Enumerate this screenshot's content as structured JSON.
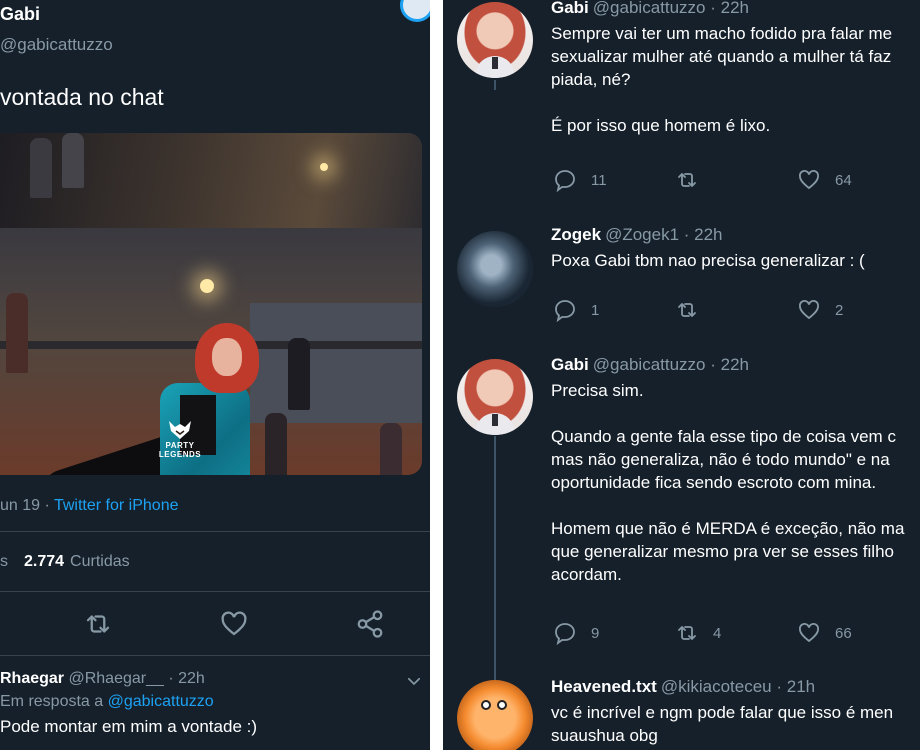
{
  "left": {
    "author": {
      "name": "Gabi",
      "handle": "@gabicattuzzo"
    },
    "tweet_text": "vontada no chat",
    "media_logo": {
      "line1": "PARTY",
      "line2": "LEGENDS"
    },
    "date": "un 19",
    "date_sep": " · ",
    "client": "Twitter for iPhone",
    "likes_prefix": "s",
    "likes_count": "2.774",
    "likes_label": "Curtidas",
    "reply": {
      "name": "Rhaegar",
      "handle": "@Rhaegar__",
      "time": "· 22h",
      "in_reply_prefix": "Em resposta a",
      "in_reply_to": "@gabicattuzzo",
      "text": "Pode montar em mim a vontade :)"
    }
  },
  "right": {
    "tweets": [
      {
        "name": "Gabi",
        "handle": "@gabicattuzzo",
        "time": "· 22h",
        "body": "Sempre vai ter um macho fodido pra falar me\nsexualizar mulher até quando a mulher tá faz\npiada, né?\n\nÉ por isso que homem é lixo.",
        "replies": "11",
        "retweets": "",
        "likes": "64"
      },
      {
        "name": "Zogek",
        "handle": "@Zogek1",
        "time": "· 22h",
        "body": "Poxa Gabi tbm nao precisa generalizar : (",
        "replies": "1",
        "retweets": "",
        "likes": "2"
      },
      {
        "name": "Gabi",
        "handle": "@gabicattuzzo",
        "time": "· 22h",
        "body": "Precisa sim.\n\nQuando a gente fala esse tipo de coisa vem c\nmas não generaliza, não é todo mundo\" e na \noportunidade fica sendo escroto com mina.\n\nHomem que não é MERDA é exceção, não ma\nque generalizar mesmo pra ver se esses filho\nacordam.",
        "replies": "9",
        "retweets": "4",
        "likes": "66"
      },
      {
        "name": "Heavened.txt",
        "handle": "@kikiacoteceu",
        "time": "· 21h",
        "body": "vc é incrível e ngm pode falar que isso é men\nsuaushua obg",
        "replies": "",
        "retweets": "",
        "likes": ""
      }
    ]
  },
  "colors": {
    "background": "#15202b",
    "text": "#ffffff",
    "muted": "#8899a6",
    "link": "#1da1f2",
    "divider": "#38444d"
  }
}
